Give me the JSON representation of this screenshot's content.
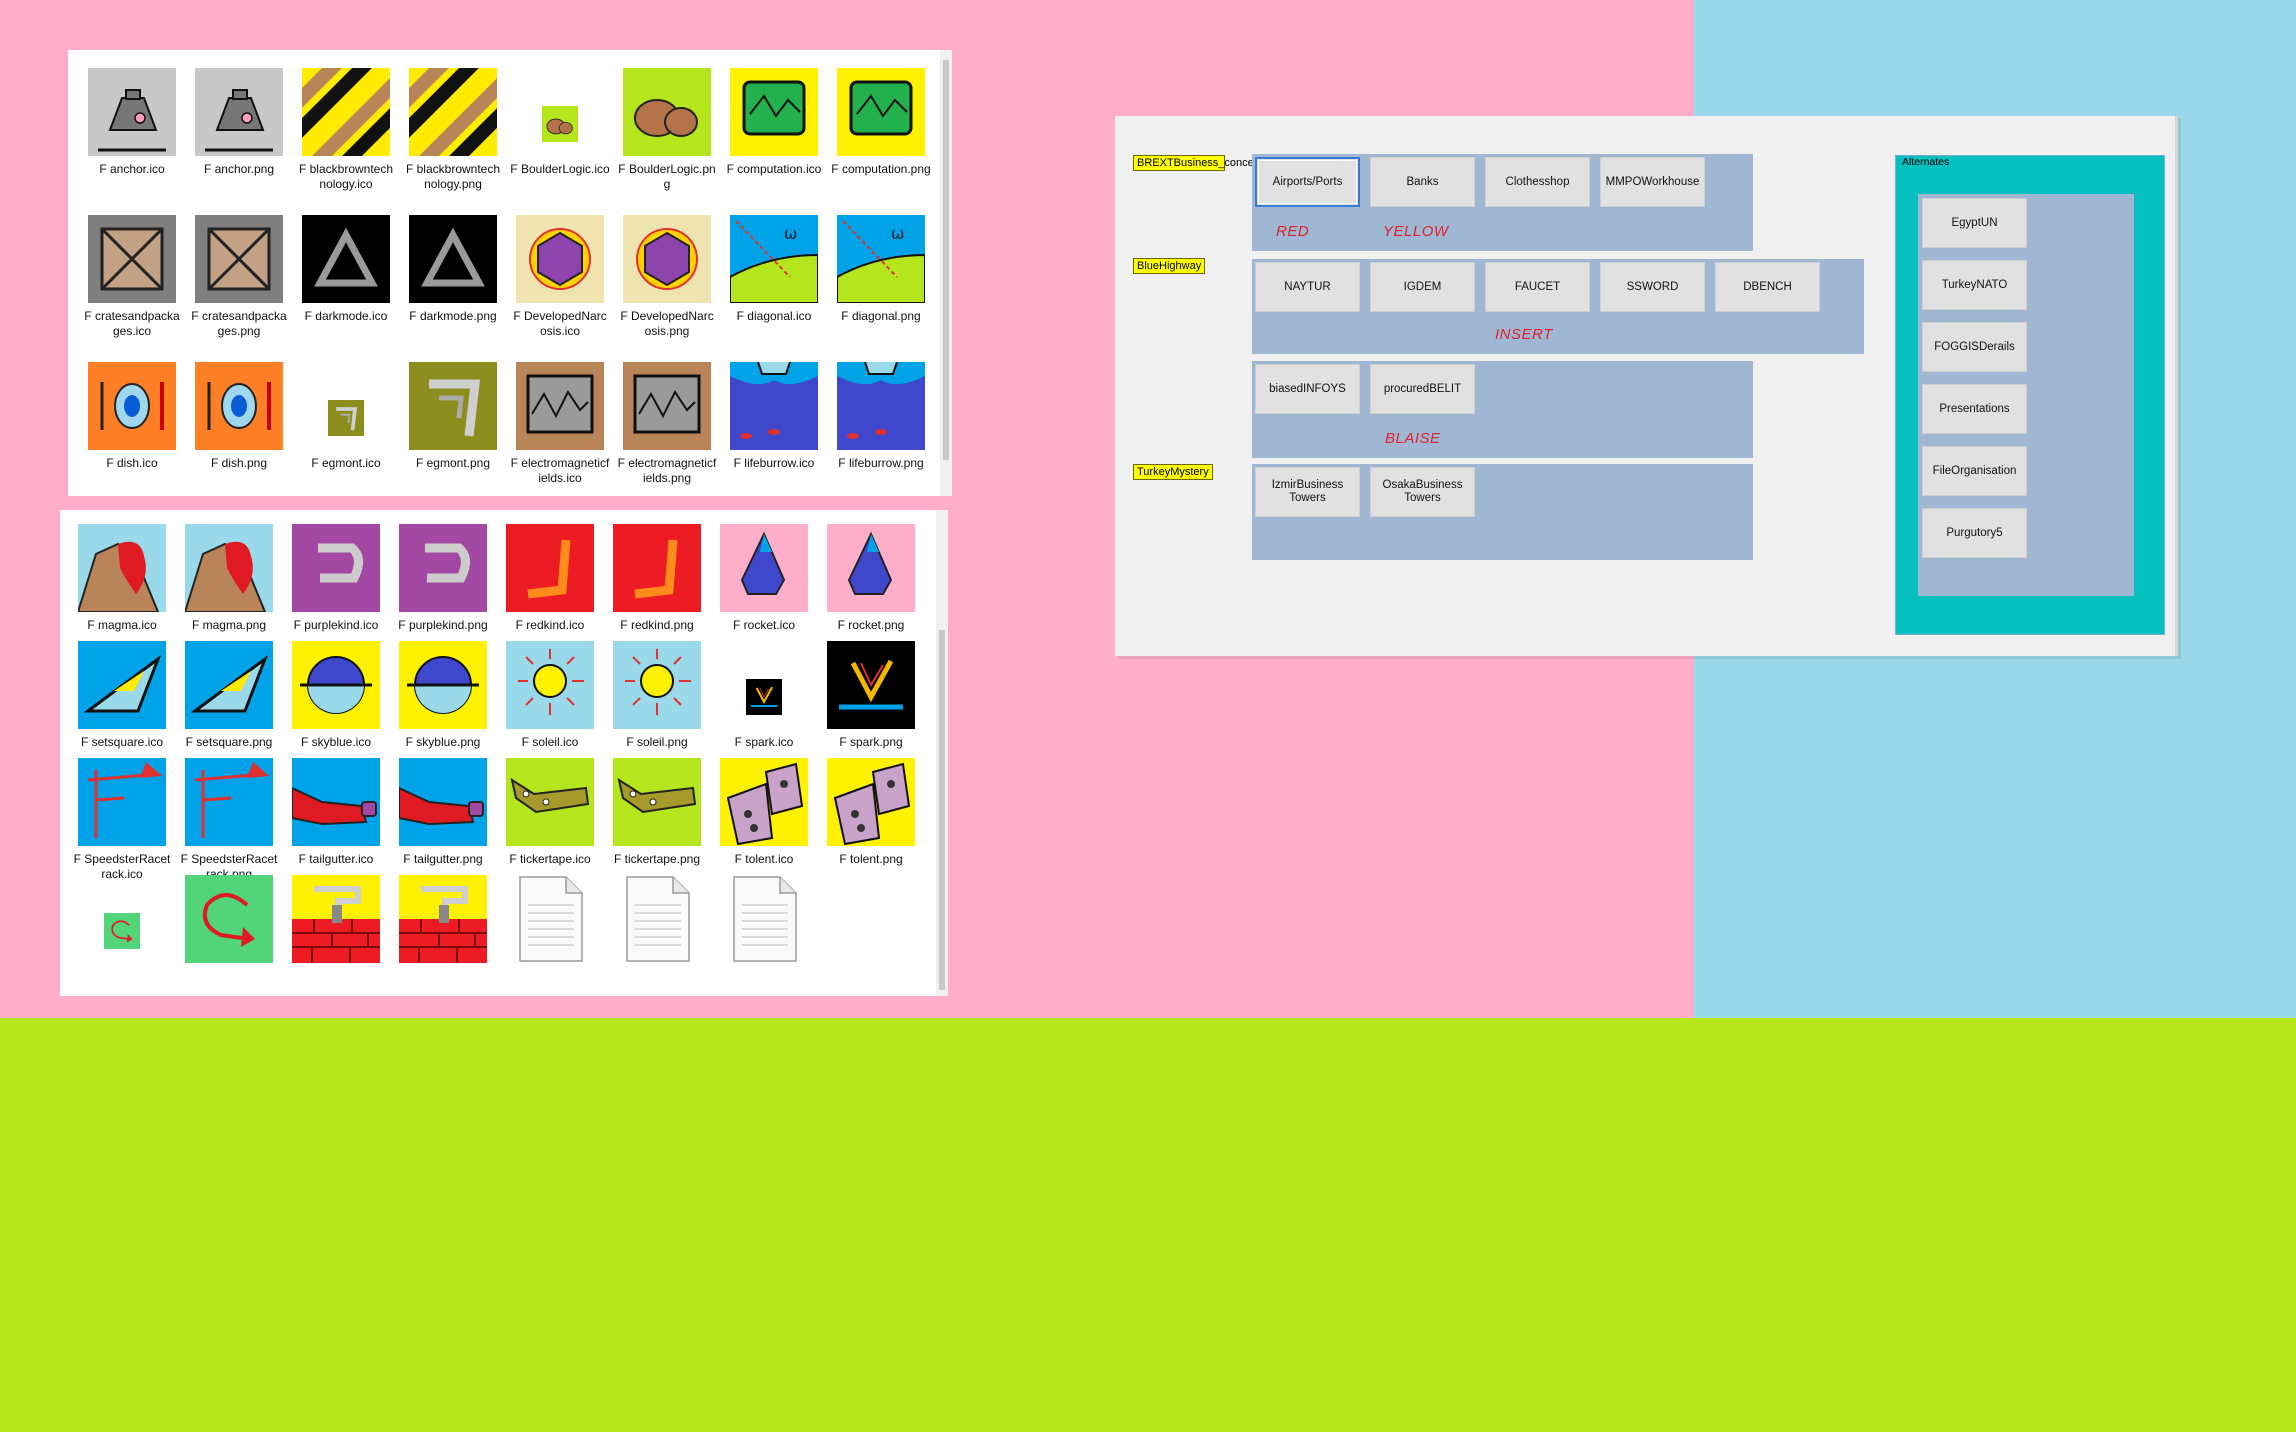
{
  "colors": {
    "pink_bg": "#ffadc9",
    "blue_bg": "#99d9ea",
    "green_bg": "#b7e61d",
    "panel": "#9fb7d3",
    "teal": "#06c0c0",
    "label_yellow": "#ffff00",
    "red_text": "#e0202a"
  },
  "explorer_top": {
    "files": [
      {
        "name": "F anchor.ico",
        "icon": "anchor-icon"
      },
      {
        "name": "F anchor.png",
        "icon": "anchor-icon"
      },
      {
        "name": "F blackbrowntechnology.ico",
        "icon": "stripes-icon"
      },
      {
        "name": "F blackbrowntechnology.png",
        "icon": "stripes-icon"
      },
      {
        "name": "F BoulderLogic.ico",
        "icon": "boulder-icon"
      },
      {
        "name": "F BoulderLogic.png",
        "icon": "boulder-icon"
      },
      {
        "name": "F computation.ico",
        "icon": "computation-icon"
      },
      {
        "name": "F computation.png",
        "icon": "computation-icon"
      },
      {
        "name": "F cratesandpackages.ico",
        "icon": "crate-icon"
      },
      {
        "name": "F cratesandpackages.png",
        "icon": "crate-icon"
      },
      {
        "name": "F darkmode.ico",
        "icon": "darkmode-triangle-icon"
      },
      {
        "name": "F darkmode.png",
        "icon": "darkmode-triangle-icon"
      },
      {
        "name": "F DevelopedNarcosis.ico",
        "icon": "hexagon-flower-icon"
      },
      {
        "name": "F DevelopedNarcosis.png",
        "icon": "hexagon-flower-icon"
      },
      {
        "name": "F diagonal.ico",
        "icon": "diagonal-icon"
      },
      {
        "name": "F diagonal.png",
        "icon": "diagonal-icon"
      },
      {
        "name": "F dish.ico",
        "icon": "dish-icon"
      },
      {
        "name": "F dish.png",
        "icon": "dish-icon"
      },
      {
        "name": "F egmont.ico",
        "icon": "egmont-icon"
      },
      {
        "name": "F egmont.png",
        "icon": "egmont-icon"
      },
      {
        "name": "F electromagneticfields.ico",
        "icon": "wave-monitor-icon"
      },
      {
        "name": "F electromagneticfields.png",
        "icon": "wave-monitor-icon"
      },
      {
        "name": "F lifeburrow.ico",
        "icon": "lifeburrow-icon"
      },
      {
        "name": "F lifeburrow.png",
        "icon": "lifeburrow-icon"
      }
    ]
  },
  "explorer_bottom": {
    "files": [
      {
        "name": "F magma.ico",
        "icon": "magma-icon"
      },
      {
        "name": "F magma.png",
        "icon": "magma-icon"
      },
      {
        "name": "F purplekind.ico",
        "icon": "purplekind-icon"
      },
      {
        "name": "F purplekind.png",
        "icon": "purplekind-icon"
      },
      {
        "name": "F redkind.ico",
        "icon": "redkind-icon"
      },
      {
        "name": "F redkind.png",
        "icon": "redkind-icon"
      },
      {
        "name": "F rocket.ico",
        "icon": "rocket-icon"
      },
      {
        "name": "F rocket.png",
        "icon": "rocket-icon"
      },
      {
        "name": "F setsquare.ico",
        "icon": "setsquare-icon"
      },
      {
        "name": "F setsquare.png",
        "icon": "setsquare-icon"
      },
      {
        "name": "F skyblue.ico",
        "icon": "skyblue-icon"
      },
      {
        "name": "F skyblue.png",
        "icon": "skyblue-icon"
      },
      {
        "name": "F soleil.ico",
        "icon": "sun-icon"
      },
      {
        "name": "F soleil.png",
        "icon": "sun-icon"
      },
      {
        "name": "F spark.ico",
        "icon": "spark-icon"
      },
      {
        "name": "F spark.png",
        "icon": "spark-icon"
      },
      {
        "name": "F SpeedsterRacetrack.ico",
        "icon": "racetrack-icon"
      },
      {
        "name": "F SpeedsterRacetrack.png",
        "icon": "racetrack-icon"
      },
      {
        "name": "F tailgutter.ico",
        "icon": "tailgutter-icon"
      },
      {
        "name": "F tailgutter.png",
        "icon": "tailgutter-icon"
      },
      {
        "name": "F tickertape.ico",
        "icon": "tickertape-icon"
      },
      {
        "name": "F tickertape.png",
        "icon": "tickertape-icon"
      },
      {
        "name": "F tolent.ico",
        "icon": "tolent-icon"
      },
      {
        "name": "F tolent.png",
        "icon": "tolent-icon"
      },
      {
        "name": "",
        "icon": "return-arrow-icon"
      },
      {
        "name": "",
        "icon": "return-arrow-icon"
      },
      {
        "name": "",
        "icon": "brick-wall-icon"
      },
      {
        "name": "",
        "icon": "brick-wall-icon"
      },
      {
        "name": "",
        "icon": "document-icon"
      },
      {
        "name": "",
        "icon": "document-icon"
      },
      {
        "name": "",
        "icon": "document-icon"
      }
    ]
  },
  "app": {
    "labels": {
      "brext": "BREXTBusiness_concerns",
      "bluehighway": "BlueHighway",
      "turkeymystery": "TurkeyMystery"
    },
    "row1_buttons": [
      "Airports/Ports",
      "Banks",
      "Clothesshop",
      "MMPOWorkhouse"
    ],
    "row1_notes": [
      "RED",
      "YELLOW"
    ],
    "row2_buttons": [
      "NAYTUR",
      "IGDEM",
      "FAUCET",
      "SSWORD",
      "DBENCH"
    ],
    "row2_notes": [
      "INSERT"
    ],
    "row3_buttons": [
      "biasedINFOYS",
      "procuredBELIT"
    ],
    "row3_notes": [
      "BLAISE"
    ],
    "row4_buttons": [
      "IzmirBusiness Towers",
      "OsakaBusiness Towers"
    ],
    "alternates": {
      "title": "Alternates",
      "buttons": [
        "EgyptUN",
        "TurkeyNATO",
        "FOGGISDerails",
        "Presentations",
        "FileOrganisation",
        "Purgutory5"
      ]
    }
  }
}
